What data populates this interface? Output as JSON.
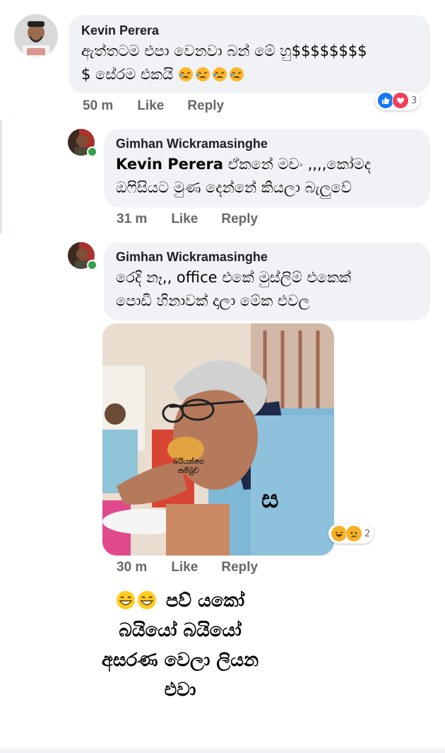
{
  "colors": {
    "bubble_bg": "#f0f2f5",
    "meta_text": "#65676b",
    "like_blue": "#1877f2",
    "love_red": "#f33e58",
    "haha_yellow": "#f7b125",
    "online_green": "#31a24c"
  },
  "comments": [
    {
      "author": "Kevin Perera",
      "text": "ඇත්තටම එපා වෙනවා බන් මේ හු$$$$$$$$",
      "text_line2": "$ සේරම එකයි",
      "time": "50 m",
      "like": "Like",
      "reply": "Reply",
      "reaction_icons": [
        "like-icon",
        "love-icon"
      ],
      "reaction_count": "3"
    },
    {
      "author": "Gimhan Wickramasinghe",
      "mention": "Kevin Perera",
      "text": "ඒකනේ මචං ,,,,කෝමද",
      "text_line2": "ඔෆිසියට මුණ දෙන්නේ කියලා බැලුවේ",
      "time": "31 m",
      "like": "Like",
      "reply": "Reply"
    },
    {
      "author": "Gimhan Wickramasinghe",
      "text": "රෙදි නෑ,, office එකේ මුස්ලිම් එකෙක්",
      "text_line2": "පොඩි හිනාවක් දාලා මේක එවල",
      "time": "30 m",
      "like": "Like",
      "reply": "Reply",
      "reaction_icons": [
        "haha-icon",
        "sad-icon"
      ],
      "reaction_count": "2",
      "photo": {
        "caption": "බයියන්ගෙ නම්බුව",
        "shirt_letter": "ස"
      }
    }
  ],
  "overlay_caption": {
    "line1": "පව් යකෝ",
    "line2": "බයියෝ බයියෝ",
    "line3": "අසරණ වෙලා ලියන",
    "line4": "එවා"
  }
}
